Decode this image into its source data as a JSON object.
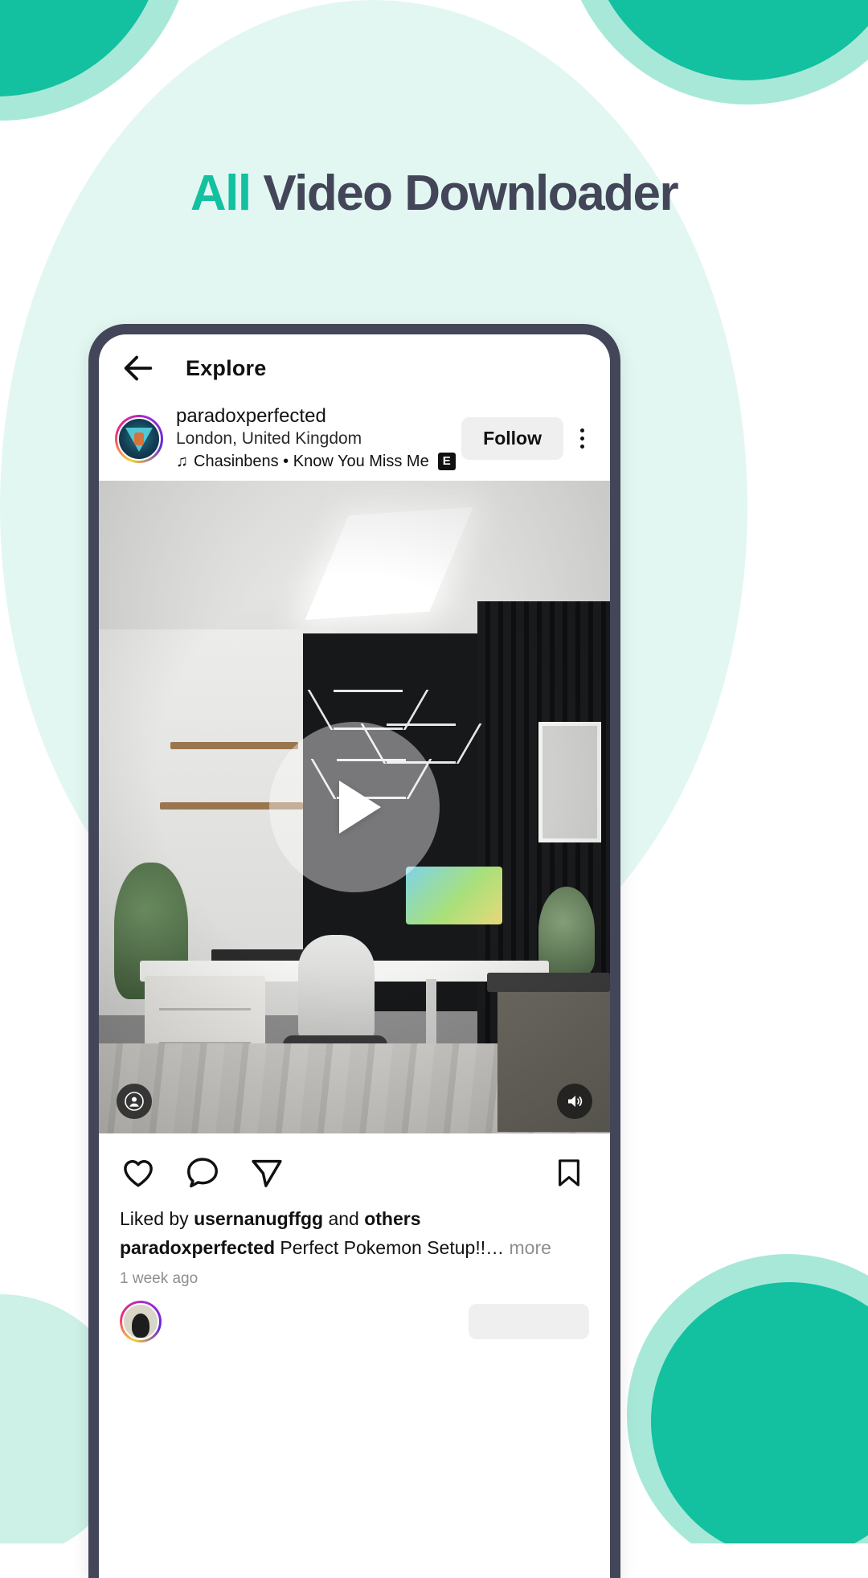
{
  "page": {
    "headline_accent": "All",
    "headline_rest": " Video Downloader"
  },
  "colors": {
    "accent_teal": "#13c0a0",
    "accent_teal_light": "#a8e8d9",
    "accent_pale": "#e3f7f2",
    "phone_frame": "#434559",
    "headline_dark": "#434559"
  },
  "phone": {
    "appbar": {
      "back_icon": "back-arrow-icon",
      "title": "Explore"
    },
    "post": {
      "username": "paradoxperfected",
      "location": "London, United Kingdom",
      "music": {
        "note_icon": "music-note-icon",
        "text": "Chasinbens • Know You Miss Me",
        "rating_badge": "E"
      },
      "follow_label": "Follow",
      "menu_icon": "kebab-menu-icon",
      "media": {
        "play_icon": "play-icon",
        "account_icon": "account-tag-icon",
        "sound_icon": "sound-on-icon"
      },
      "actions": {
        "like_icon": "heart-icon",
        "comment_icon": "comment-icon",
        "share_icon": "share-icon",
        "save_icon": "bookmark-icon"
      },
      "likes_prefix": "Liked by ",
      "likes_user": "usernanugffgg",
      "likes_middle": " and ",
      "likes_suffix": "others",
      "caption_user": "paradoxperfected",
      "caption_text": " Perfect Pokemon Setup!!…",
      "caption_more": " more",
      "timestamp": "1 week ago"
    }
  }
}
